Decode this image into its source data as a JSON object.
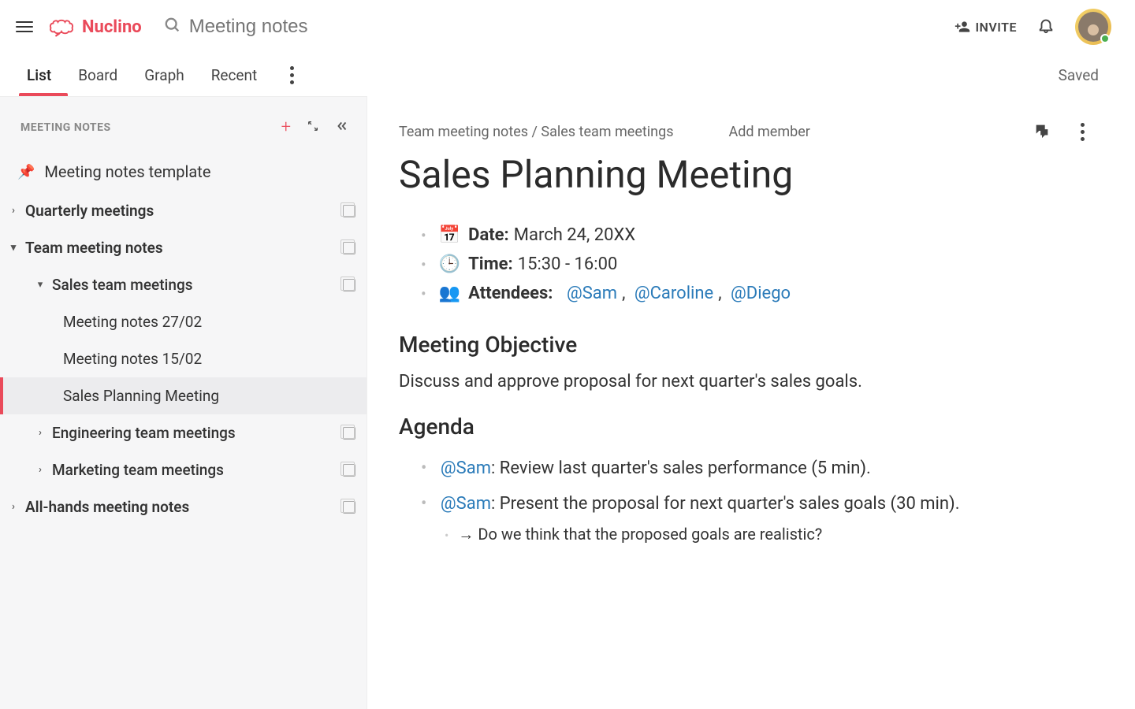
{
  "header": {
    "brand": "Nuclino",
    "search_placeholder": "Meeting notes",
    "invite": "INVITE",
    "saved": "Saved"
  },
  "tabs": {
    "list": "List",
    "board": "Board",
    "graph": "Graph",
    "recent": "Recent"
  },
  "sidebar": {
    "title": "MEETING NOTES",
    "pinned": "Meeting notes template",
    "items": [
      {
        "label": "Quarterly meetings",
        "level": 1,
        "expanded": false,
        "hasChildren": true,
        "stack": true
      },
      {
        "label": "Team meeting notes",
        "level": 1,
        "expanded": true,
        "hasChildren": true,
        "stack": true
      },
      {
        "label": "Sales team meetings",
        "level": 2,
        "expanded": true,
        "hasChildren": true,
        "stack": true
      },
      {
        "label": "Meeting notes 27/02",
        "level": 3,
        "expanded": false,
        "hasChildren": false,
        "stack": false
      },
      {
        "label": "Meeting notes 15/02",
        "level": 3,
        "expanded": false,
        "hasChildren": false,
        "stack": false
      },
      {
        "label": "Sales Planning Meeting",
        "level": 3,
        "expanded": false,
        "hasChildren": false,
        "stack": false,
        "selected": true
      },
      {
        "label": "Engineering team meetings",
        "level": 2,
        "expanded": false,
        "hasChildren": true,
        "stack": true
      },
      {
        "label": "Marketing team meetings",
        "level": 2,
        "expanded": false,
        "hasChildren": true,
        "stack": true
      },
      {
        "label": "All-hands meeting notes",
        "level": 1,
        "expanded": false,
        "hasChildren": true,
        "stack": true
      }
    ]
  },
  "content": {
    "breadcrumb": "Team meeting notes / Sales team meetings",
    "add_member": "Add member",
    "title": "Sales Planning Meeting",
    "meta": {
      "date_label": "Date:",
      "date_value": "March 24, 20XX",
      "time_label": "Time:",
      "time_value": "15:30 - 16:00",
      "attendees_label": "Attendees:",
      "attendees": [
        "@Sam",
        "@Caroline",
        "@Diego"
      ]
    },
    "objective_heading": "Meeting Objective",
    "objective_text": "Discuss and approve proposal for next quarter's sales goals.",
    "agenda_heading": "Agenda",
    "agenda": {
      "item1_mention": "@Sam",
      "item1_text": ": Review last quarter's sales performance (5 min).",
      "item2_mention": "@Sam",
      "item2_text": ": Present the proposal for next quarter's sales goals (30 min).",
      "sub_text": "→ Do we think that the proposed goals are realistic?"
    }
  }
}
